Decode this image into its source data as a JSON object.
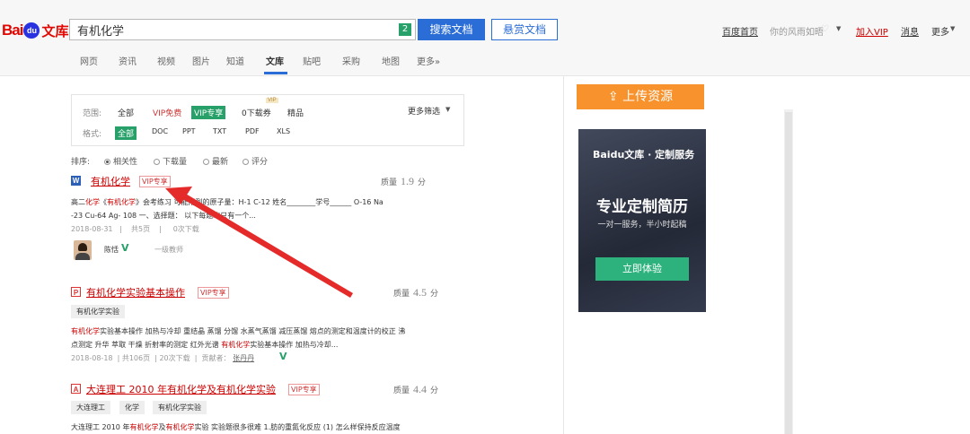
{
  "logo": {
    "text_bai": "Bai",
    "text_du": "du",
    "text_wenku": "文库"
  },
  "search": {
    "value": "有机化学",
    "count": "2",
    "btn_search": "搜索文档",
    "btn_reward": "悬赏文档"
  },
  "toplinks": {
    "home": "百度首页",
    "user": "你的风雨如晤",
    "join_vip": "加入VIP",
    "message": "消息",
    "more": "更多"
  },
  "nav": [
    "网页",
    "资讯",
    "视频",
    "图片",
    "知道",
    "文库",
    "贴吧",
    "采购",
    "地图",
    "更多»"
  ],
  "filter": {
    "range_label": "范围:",
    "range": [
      "全部",
      "VIP免费",
      "VIP专享",
      "0下载券",
      "精品"
    ],
    "vip_mini": "VIP",
    "more": "更多筛选",
    "format_label": "格式:",
    "formats": [
      "全部",
      "DOC",
      "PPT",
      "TXT",
      "PDF",
      "XLS"
    ]
  },
  "sort": {
    "label": "排序:",
    "options": [
      "相关性",
      "下载量",
      "最新",
      "评分"
    ]
  },
  "results": [
    {
      "icon": "W",
      "title": "有机化学",
      "vip": "VIP专享",
      "quality_label": "质量",
      "quality": "1.9",
      "quality_unit": "分",
      "snip1_a": "高二",
      "snip1_em1": "化学",
      "snip1_b": "《",
      "snip1_em2": "有机化学",
      "snip1_c": "》会考练习  可能用到的原子量：H-1 C-12 姓名________学号______ O-16 Na",
      "snip2": "-23 Cu-64 Ag- 108 一、选择题：   以下每题均只有一个...",
      "meta": [
        "2018-08-31",
        "|",
        "共5页",
        "|",
        "0次下载"
      ],
      "author": "陈恬",
      "author_role": "一级教师"
    },
    {
      "icon": "P",
      "title": "有机化学实验基本操作",
      "vip": "VIP专享",
      "quality_label": "质量",
      "quality": "4.5",
      "quality_unit": "分",
      "tags": [
        "有机化学实验"
      ],
      "snip1_em1": "有机化学",
      "snip1_a": "实验基本操作  加热与冷却  重结晶  蒸馏  分馏  水蒸气蒸馏  减压蒸馏  熔点的测定和温度计的校正  沸",
      "snip2_a": "点测定  升华  萃取  干燥  折射率的测定  红外光谱  ",
      "snip2_em": "有机化学",
      "snip2_b": "实验基本操作  加热与冷却...",
      "meta": [
        "2018-08-18",
        "|",
        "共106页",
        "|",
        "20次下载",
        "|",
        "贡献者：",
        "张丹丹"
      ]
    },
    {
      "icon": "A",
      "title": "大连理工 2010 年有机化学及有机化学实验",
      "vip": "VIP专享",
      "quality_label": "质量",
      "quality": "4.4",
      "quality_unit": "分",
      "tags": [
        "大连理工",
        "化学",
        "有机化学实验"
      ],
      "snip1_a": "大连理工 2010 年",
      "snip1_em1": "有机化学",
      "snip1_b": "及",
      "snip1_em2": "有机化学",
      "snip1_c": "实验  实验题很多很难 1.肪的重氮化反应 (1) 怎么样保持反应温度"
    }
  ],
  "sidebar": {
    "upload": "上传资源",
    "ad_logo": "Baidu文库 · 定制服务",
    "ad_title": "专业定制简历",
    "ad_sub": "一对一服务，半小时起稿",
    "ad_btn": "立即体验"
  }
}
